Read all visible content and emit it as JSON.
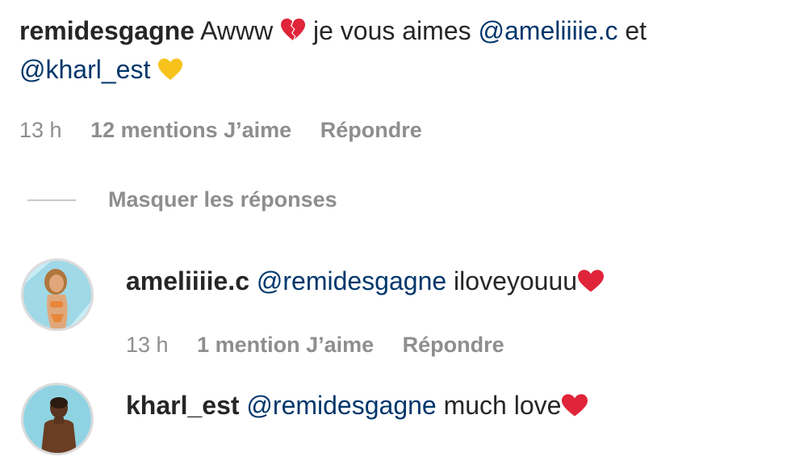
{
  "main_comment": {
    "username": "remidesgagne",
    "text_1": "Awww",
    "text_2": "je vous aimes",
    "mention_1": "@ameliiiie.c",
    "text_3": "et",
    "mention_2": "@kharl_est",
    "time": "13 h",
    "likes": "12 mentions J’aime",
    "reply": "Répondre"
  },
  "replies_toggle": {
    "label": "Masquer les réponses"
  },
  "replies": [
    {
      "username": "ameliiiie.c",
      "mention": "@remidesgagne",
      "text": "iloveyouuu",
      "time": "13 h",
      "likes": "1 mention J’aime",
      "reply": "Répondre"
    },
    {
      "username": "kharl_est",
      "mention": "@remidesgagne",
      "text": "much love"
    }
  ],
  "colors": {
    "mention": "#00376b",
    "meta": "#8e8e8e",
    "text": "#262626",
    "heart": "#e0243a"
  },
  "icons": [
    "broken-heart-icon",
    "yellow-heart-icon",
    "red-heart-icon"
  ]
}
